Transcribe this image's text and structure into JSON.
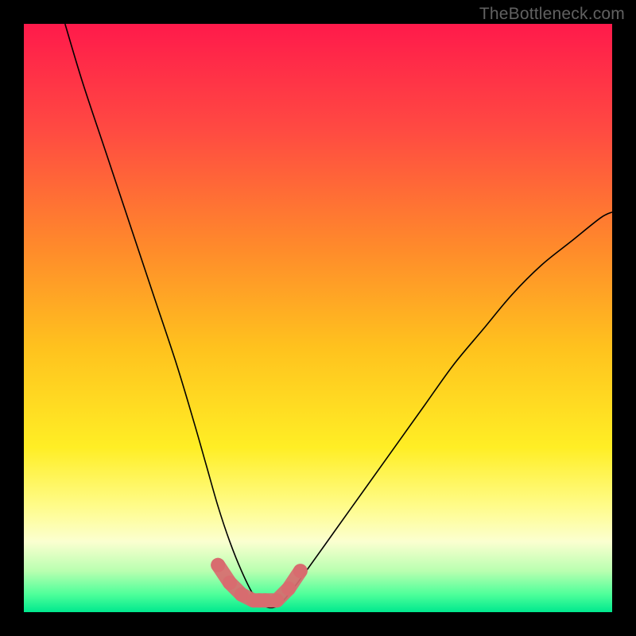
{
  "watermark": "TheBottleneck.com",
  "chart_data": {
    "type": "line",
    "title": "",
    "xlabel": "",
    "ylabel": "",
    "xlim": [
      0,
      100
    ],
    "ylim": [
      0,
      100
    ],
    "grid": false,
    "legend": false,
    "background": {
      "type": "vertical-gradient",
      "stops": [
        {
          "pos": 0.0,
          "color": "#ff1a4b"
        },
        {
          "pos": 0.18,
          "color": "#ff4a42"
        },
        {
          "pos": 0.38,
          "color": "#ff8a2b"
        },
        {
          "pos": 0.55,
          "color": "#ffc21e"
        },
        {
          "pos": 0.72,
          "color": "#ffee25"
        },
        {
          "pos": 0.82,
          "color": "#fffc8a"
        },
        {
          "pos": 0.88,
          "color": "#fbffd0"
        },
        {
          "pos": 0.93,
          "color": "#b9ffb0"
        },
        {
          "pos": 0.97,
          "color": "#4dff9a"
        },
        {
          "pos": 1.0,
          "color": "#00e88e"
        }
      ]
    },
    "series": [
      {
        "name": "bottleneck-curve",
        "color": "#000000",
        "width": 1.6,
        "x": [
          7,
          10,
          14,
          18,
          22,
          26,
          29,
          31,
          33,
          35,
          37,
          39,
          41,
          43,
          45,
          48,
          53,
          58,
          63,
          68,
          73,
          78,
          83,
          88,
          93,
          98,
          100
        ],
        "y": [
          100,
          90,
          78,
          66,
          54,
          42,
          32,
          25,
          18,
          12,
          7,
          3,
          1,
          1,
          3,
          7,
          14,
          21,
          28,
          35,
          42,
          48,
          54,
          59,
          63,
          67,
          68
        ]
      },
      {
        "name": "optimal-marker",
        "color": "#d86b6f",
        "type": "area-band",
        "x": [
          33,
          35,
          37,
          39,
          40,
          41,
          43,
          45,
          47
        ],
        "y": [
          8,
          5,
          3,
          2,
          2,
          2,
          2,
          4,
          7
        ],
        "band_thickness": 6
      }
    ],
    "annotations": []
  }
}
